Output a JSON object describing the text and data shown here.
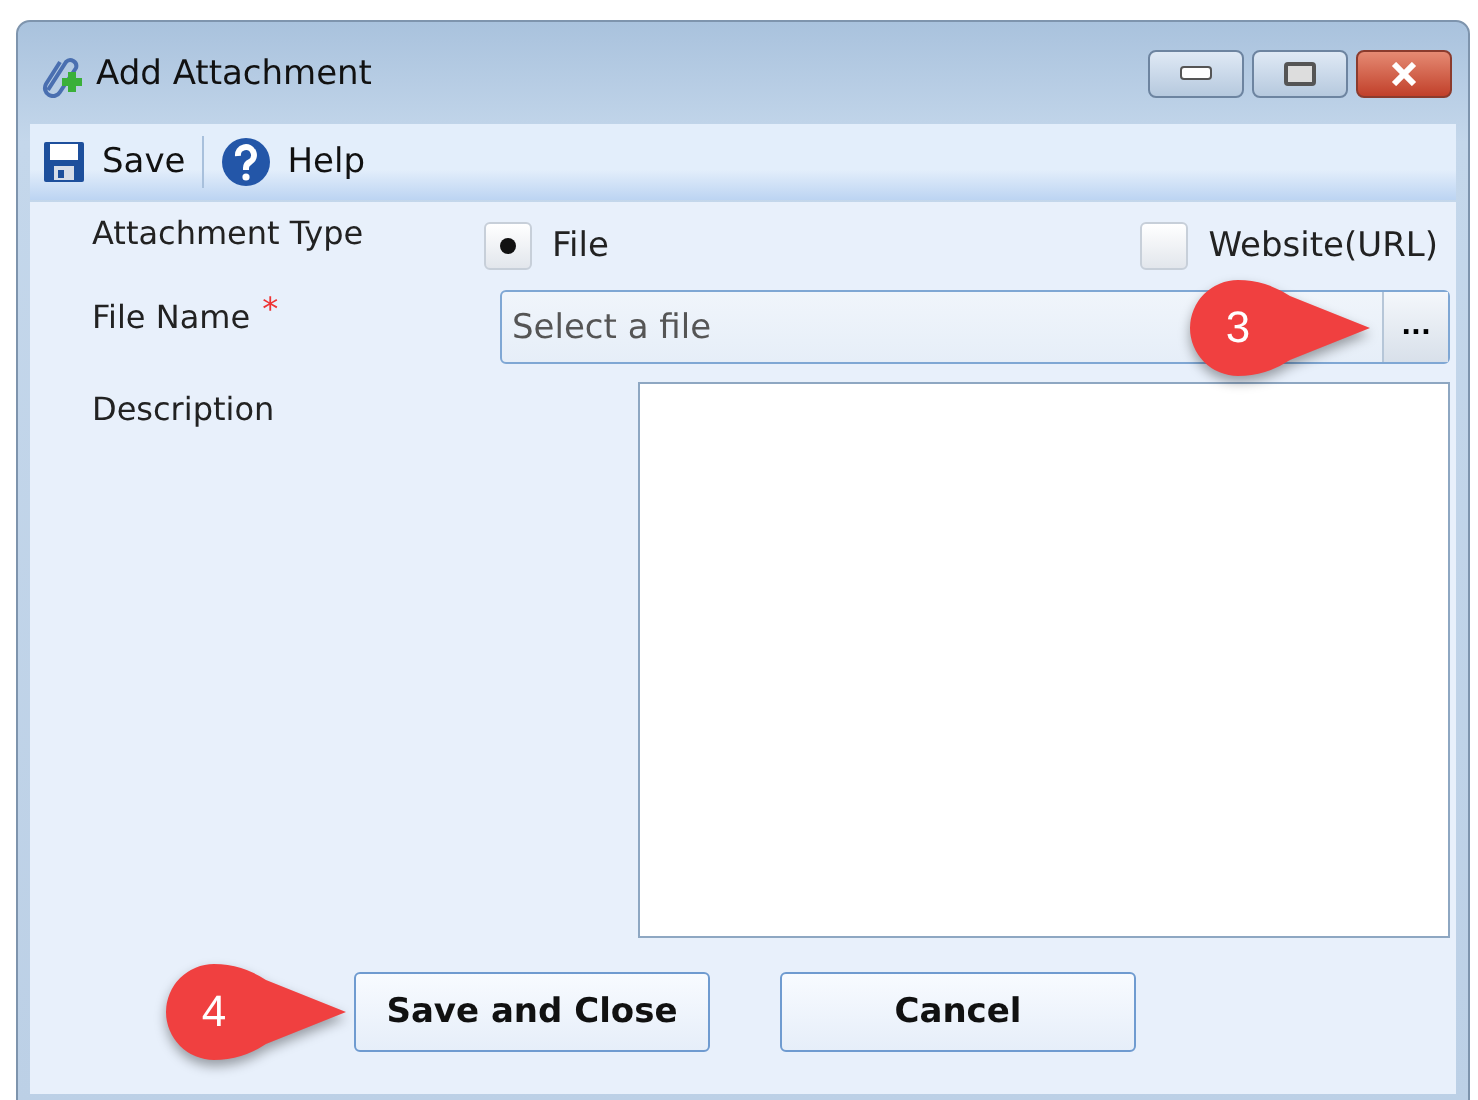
{
  "window": {
    "title": "Add Attachment"
  },
  "toolbar": [
    {
      "kind": "save",
      "label": "Save"
    },
    {
      "kind": "help",
      "label": "Help"
    }
  ],
  "form": {
    "attachment_type": {
      "label": "Attachment Type",
      "options": [
        {
          "label": "File",
          "selected": true
        },
        {
          "label": "Website(URL)",
          "selected": false
        }
      ]
    },
    "file_name": {
      "label": "File Name",
      "required_mark": "*",
      "placeholder": "Select a file",
      "browse": "..."
    },
    "description": {
      "label": "Description"
    }
  },
  "buttons": [
    {
      "kind": "primary",
      "label": "Save and Close"
    },
    {
      "kind": "cancel",
      "label": "Cancel"
    }
  ],
  "callouts": [
    {
      "number": "3"
    },
    {
      "number": "4"
    }
  ]
}
